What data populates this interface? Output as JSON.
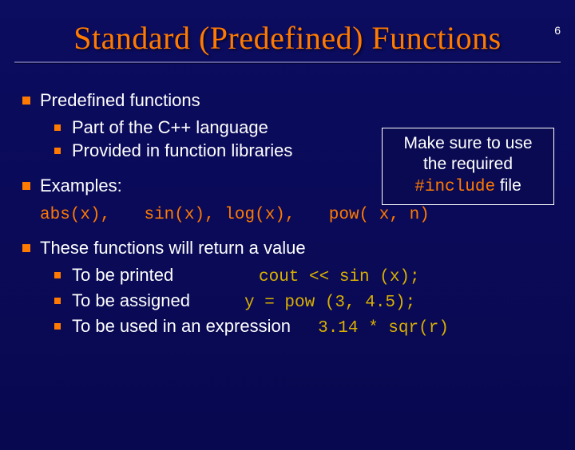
{
  "page_number": "6",
  "title": "Standard (Predefined) Functions",
  "note": {
    "line1": "Make sure to use",
    "line2": "the required",
    "code": "#include",
    "line3": " file"
  },
  "items": {
    "predefined": {
      "heading": "Predefined functions",
      "sub1": "Part of the C++ language",
      "sub2": "Provided in function libraries"
    },
    "examples": {
      "heading": "Examples:",
      "e1": "abs(x),",
      "e2": "sin(x), log(x),",
      "e3": "pow( x, n)"
    },
    "returns": {
      "heading": "These functions will return a value",
      "sub1_text": "To be printed",
      "sub1_code": "cout << sin (x);",
      "sub2_text": "To be assigned",
      "sub2_code": "y = pow (3, 4.5);",
      "sub3_text": "To be used in an expression",
      "sub3_code": "3.14 * sqr(r)"
    }
  }
}
